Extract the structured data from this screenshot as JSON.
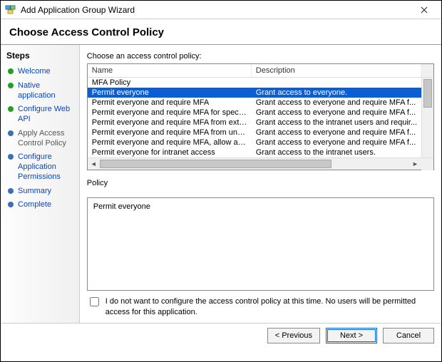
{
  "window": {
    "title": "Add Application Group Wizard"
  },
  "header": {
    "title": "Choose Access Control Policy"
  },
  "sidebar": {
    "title": "Steps",
    "items": [
      {
        "label": "Welcome",
        "state": "done"
      },
      {
        "label": "Native application",
        "state": "done"
      },
      {
        "label": "Configure Web API",
        "state": "done"
      },
      {
        "label": "Apply Access Control Policy",
        "state": "current"
      },
      {
        "label": "Configure Application Permissions",
        "state": "upcoming"
      },
      {
        "label": "Summary",
        "state": "upcoming"
      },
      {
        "label": "Complete",
        "state": "upcoming"
      }
    ]
  },
  "main": {
    "choose_label": "Choose an access control policy:",
    "columns": {
      "name": "Name",
      "description": "Description"
    },
    "rows": [
      {
        "name": "MFA Policy",
        "desc": "",
        "selected": false
      },
      {
        "name": "Permit everyone",
        "desc": "Grant access to everyone.",
        "selected": true
      },
      {
        "name": "Permit everyone and require MFA",
        "desc": "Grant access to everyone and require MFA f...",
        "selected": false
      },
      {
        "name": "Permit everyone and require MFA for specific group",
        "desc": "Grant access to everyone and require MFA f...",
        "selected": false
      },
      {
        "name": "Permit everyone and require MFA from extranet access",
        "desc": "Grant access to the intranet users and requir...",
        "selected": false
      },
      {
        "name": "Permit everyone and require MFA from unauthenticated ...",
        "desc": "Grant access to everyone and require MFA f...",
        "selected": false
      },
      {
        "name": "Permit everyone and require MFA, allow automatic devi...",
        "desc": "Grant access to everyone and require MFA f...",
        "selected": false
      },
      {
        "name": "Permit everyone for intranet access",
        "desc": "Grant access to the intranet users.",
        "selected": false
      }
    ],
    "policy_label": "Policy",
    "policy_text": "Permit everyone",
    "skip_checkbox_label": "I do not want to configure the access control policy at this time.  No users will be permitted access for this application.",
    "skip_checked": false
  },
  "footer": {
    "previous": "< Previous",
    "next": "Next >",
    "cancel": "Cancel"
  }
}
